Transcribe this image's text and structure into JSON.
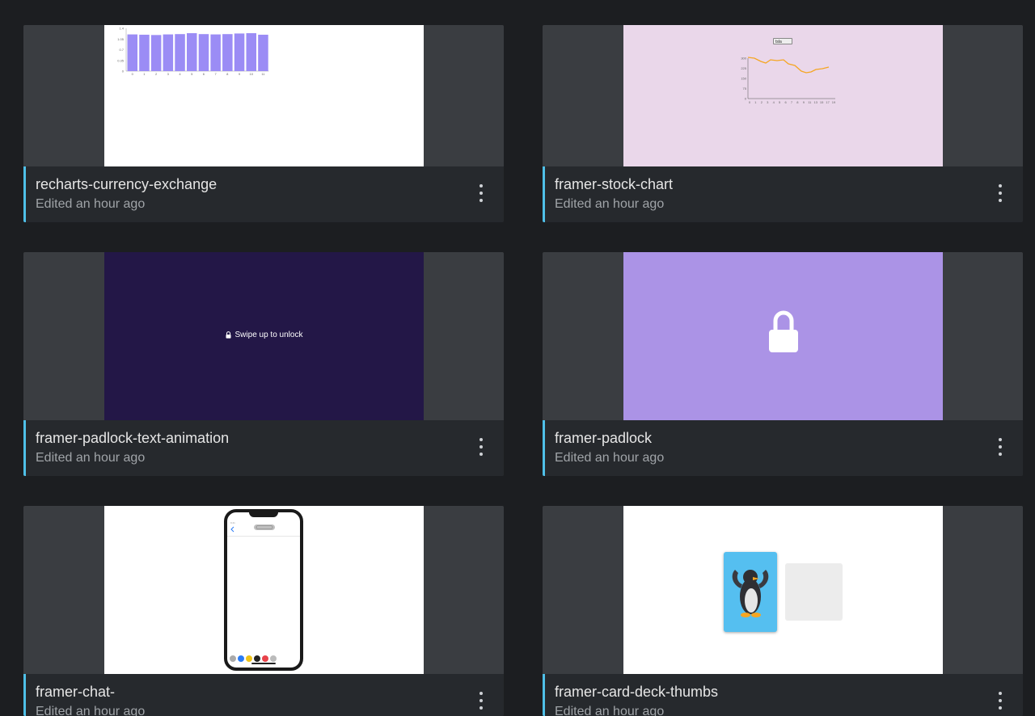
{
  "projects": [
    {
      "title": "recharts-currency-exchange",
      "subtitle": "Edited an hour ago",
      "preview": {
        "type": "bar-chart",
        "y_ticks": [
          "1.4",
          "1.05",
          "0.7",
          "0.35",
          "0"
        ],
        "x_ticks": [
          "0",
          "1",
          "2",
          "3",
          "4",
          "5",
          "6",
          "7",
          "8",
          "9",
          "10",
          "11"
        ],
        "values": [
          1.2,
          1.19,
          1.18,
          1.2,
          1.21,
          1.24,
          1.21,
          1.2,
          1.21,
          1.23,
          1.24,
          1.19
        ],
        "bar_color": "#9b8cf5"
      }
    },
    {
      "title": "framer-stock-chart",
      "subtitle": "Edited an hour ago",
      "preview": {
        "type": "line-chart",
        "select_value": "tsla",
        "y_ticks": [
          "300",
          "225",
          "150",
          "75",
          "0"
        ],
        "x_ticks": [
          "0",
          "1",
          "2",
          "3",
          "4",
          "5",
          "6",
          "7",
          "8",
          "9",
          "11",
          "13",
          "15",
          "17",
          "19"
        ],
        "background": "#ead7ea",
        "line_color": "#f5a623"
      }
    },
    {
      "title": "framer-padlock-text-animation",
      "subtitle": "Edited an hour ago",
      "preview": {
        "type": "padlock-text",
        "text": "Swipe up to unlock",
        "background": "#231747"
      }
    },
    {
      "title": "framer-padlock",
      "subtitle": "Edited an hour ago",
      "preview": {
        "type": "padlock",
        "background": "#ab93e6"
      }
    },
    {
      "title": "framer-chat-",
      "subtitle": "Edited an hour ago",
      "preview": {
        "type": "phone"
      }
    },
    {
      "title": "framer-card-deck-thumbs",
      "subtitle": "Edited an hour ago",
      "preview": {
        "type": "card-deck",
        "card_color": "#55bff0"
      }
    }
  ],
  "colors": {
    "background": "#1c1e21",
    "card_footer": "#26292d",
    "thumb_backdrop": "#3a3d41",
    "accent": "#4fc0e8"
  },
  "icons": {
    "menu": "more-vertical-icon",
    "lock": "lock-icon"
  }
}
